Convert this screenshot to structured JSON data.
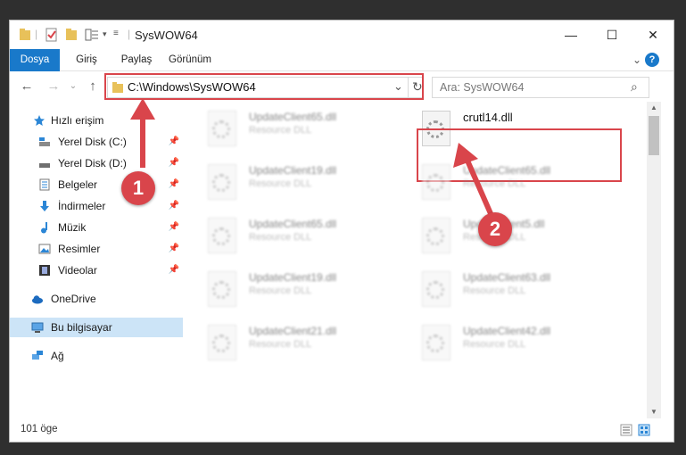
{
  "window": {
    "title": "SysWOW64",
    "minimize": "—",
    "maximize": "☐",
    "close": "✕"
  },
  "ribbon": {
    "tabs": [
      "Dosya",
      "Giriş",
      "Paylaş",
      "Görünüm"
    ],
    "expand_icon": "⌄",
    "help_icon": "?"
  },
  "address": {
    "path": "C:\\Windows\\SysWOW64",
    "search_placeholder": "Ara: SysWOW64",
    "back": "←",
    "forward": "→",
    "recent": "⌄",
    "up": "↑",
    "refresh": "↻",
    "dropdown": "⌄",
    "search_glyph": "⌕"
  },
  "nav": {
    "quick_access": "Hızlı erişim",
    "items": [
      {
        "label": "Yerel Disk (C:)"
      },
      {
        "label": "Yerel Disk (D:)"
      },
      {
        "label": "Belgeler"
      },
      {
        "label": "İndirmeler"
      },
      {
        "label": "Müzik"
      },
      {
        "label": "Resimler"
      },
      {
        "label": "Videolar"
      }
    ],
    "onedrive": "OneDrive",
    "this_pc": "Bu bilgisayar",
    "network": "Ağ"
  },
  "files": {
    "col1": [
      {
        "name": "UpdateClient65.dll",
        "desc": "Resource DLL"
      },
      {
        "name": "UpdateClient19.dll",
        "desc": "Resource DLL"
      },
      {
        "name": "UpdateClient65.dll",
        "desc": "Resource DLL"
      },
      {
        "name": "UpdateClient19.dll",
        "desc": "Resource DLL"
      },
      {
        "name": "UpdateClient21.dll",
        "desc": "Resource DLL"
      }
    ],
    "col2": [
      {
        "name": "crutl14.dll",
        "desc": ""
      },
      {
        "name": "UpdateClient65.dll",
        "desc": "Resource DLL"
      },
      {
        "name": "UpdateClient5.dll",
        "desc": "Resource DLL"
      },
      {
        "name": "UpdateClient63.dll",
        "desc": "Resource DLL"
      },
      {
        "name": "UpdateClient42.dll",
        "desc": "Resource DLL"
      }
    ]
  },
  "status": {
    "count": "101 öge"
  },
  "annotations": {
    "step1": "1",
    "step2": "2",
    "color": "#d9454b"
  }
}
